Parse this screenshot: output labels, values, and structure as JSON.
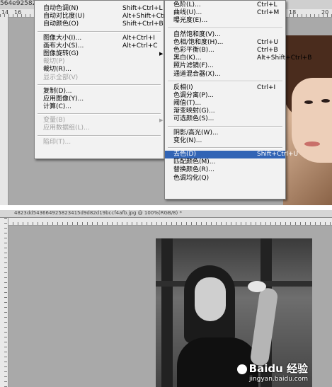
{
  "top": {
    "tab_text": "564e92582",
    "ruler_numbers": [
      "14",
      "16",
      "18",
      "20"
    ],
    "left_menu": [
      {
        "label": "自动色调(N)",
        "shortcut": "Shift+Ctrl+L"
      },
      {
        "label": "自动对比度(U)",
        "shortcut": "Alt+Shift+Ctrl+L"
      },
      {
        "label": "自动颜色(O)",
        "shortcut": "Shift+Ctrl+B"
      },
      {
        "sep": true
      },
      {
        "label": "图像大小(I)...",
        "shortcut": "Alt+Ctrl+I"
      },
      {
        "label": "画布大小(S)...",
        "shortcut": "Alt+Ctrl+C"
      },
      {
        "label": "图像旋转(G)",
        "submenu": true
      },
      {
        "label": "裁切(P)",
        "disabled": true
      },
      {
        "label": "裁切(R)...",
        "disabled": false
      },
      {
        "label": "显示全部(V)",
        "disabled": true
      },
      {
        "sep": true
      },
      {
        "label": "复制(D)..."
      },
      {
        "label": "应用图像(Y)..."
      },
      {
        "label": "计算(C)..."
      },
      {
        "sep": true
      },
      {
        "label": "变量(B)",
        "submenu": true,
        "disabled": true
      },
      {
        "label": "应用数据组(L)...",
        "disabled": true
      },
      {
        "sep": true
      },
      {
        "label": "陷印(T)...",
        "disabled": true
      }
    ],
    "right_menu": [
      {
        "label": "色阶(L)...",
        "shortcut": "Ctrl+L"
      },
      {
        "label": "曲线(U)...",
        "shortcut": "Ctrl+M"
      },
      {
        "label": "曝光度(E)..."
      },
      {
        "sep": true
      },
      {
        "label": "自然饱和度(V)..."
      },
      {
        "label": "色相/饱和度(H)...",
        "shortcut": "Ctrl+U"
      },
      {
        "label": "色彩平衡(B)...",
        "shortcut": "Ctrl+B"
      },
      {
        "label": "黑白(K)...",
        "shortcut": "Alt+Shift+Ctrl+B"
      },
      {
        "label": "照片滤镜(F)..."
      },
      {
        "label": "通道混合器(X)..."
      },
      {
        "sep": true
      },
      {
        "label": "反相(I)",
        "shortcut": "Ctrl+I"
      },
      {
        "label": "色调分离(P)..."
      },
      {
        "label": "阈值(T)..."
      },
      {
        "label": "渐变映射(G)..."
      },
      {
        "label": "可选颜色(S)..."
      },
      {
        "sep": true
      },
      {
        "label": "阴影/高光(W)..."
      },
      {
        "label": "变化(N)..."
      },
      {
        "sep": true
      },
      {
        "label": "去色(D)",
        "shortcut": "Shift+Ctrl+U",
        "highlighted": true
      },
      {
        "label": "匹配颜色(M)..."
      },
      {
        "label": "替换颜色(R)..."
      },
      {
        "label": "色调均化(Q)"
      }
    ]
  },
  "bottom": {
    "title_text": "4823dd543664925823415d9d82d19bccf4afb.jpg @ 100%(RGB/8) *",
    "watermark_main": "Baidu 经验",
    "watermark_sub": "jingyan.baidu.com"
  },
  "colors": {
    "highlight": "#3164b5",
    "menu_bg": "#f2f2f2",
    "canvas_bg": "#a9a9a9"
  }
}
